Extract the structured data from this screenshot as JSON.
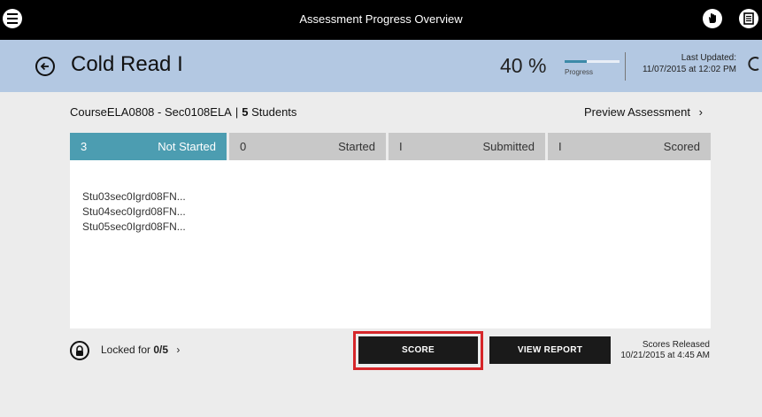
{
  "app": {
    "title": "Assessment Progress Overview"
  },
  "header": {
    "title": "Cold Read I",
    "progress_text": "40 %",
    "progress_value": 0.4,
    "progress_label": "Progress",
    "updated_label": "Last Updated:",
    "updated_date": "11/07/2015 at 12:02 PM"
  },
  "course": {
    "name": "CourseELA0808 - Sec0108ELA",
    "separator": "|",
    "student_count": "5",
    "students_word": "Students",
    "preview_link": "Preview Assessment",
    "preview_chevron": "›"
  },
  "tabs": [
    {
      "count": "3",
      "label": "Not Started"
    },
    {
      "count": "0",
      "label": "Started"
    },
    {
      "count": "I",
      "label": "Submitted"
    },
    {
      "count": "I",
      "label": "Scored"
    }
  ],
  "students": [
    "Stu03sec0Igrd08FN...",
    "Stu04sec0Igrd08FN...",
    "Stu05sec0Igrd08FN..."
  ],
  "footer": {
    "locked_prefix": "Locked for ",
    "locked_value": "0/5",
    "locked_chevron": "›",
    "score_button": "SCORE",
    "report_button": "VIEW REPORT",
    "released_label": "Scores Released",
    "released_date": "10/21/2015 at 4:45 AM"
  },
  "colors": {
    "accent": "#4c9db1",
    "header_bg": "#b3c8e2",
    "highlight": "#d6262a"
  },
  "icons": [
    "menu-icon",
    "hand-icon",
    "notes-icon",
    "back-arrow-icon",
    "refresh-icon",
    "lock-icon",
    "chevron-right-icon"
  ]
}
